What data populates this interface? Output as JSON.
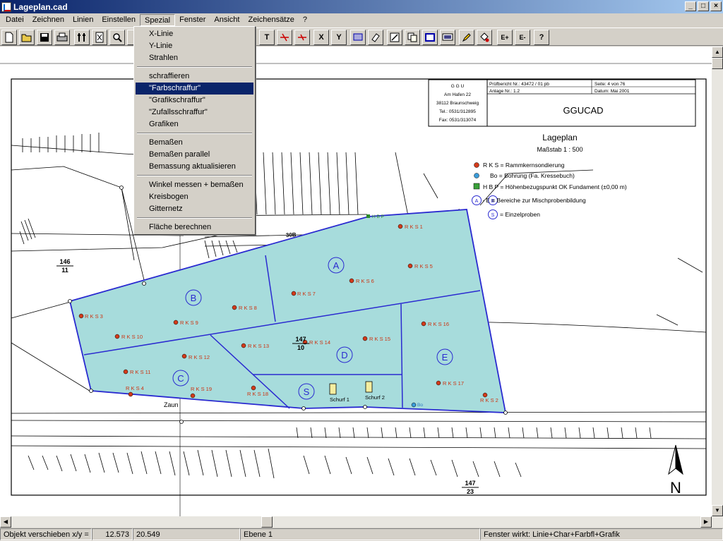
{
  "window": {
    "title": "Lageplan.cad",
    "min": "_",
    "max": "□",
    "close": "×"
  },
  "menu": [
    "Datei",
    "Zeichnen",
    "Linien",
    "Einstellen",
    "Spezial",
    "Fenster",
    "Ansicht",
    "Zeichensätze",
    "?"
  ],
  "toolbar_glyphs": [
    "T",
    "X",
    "Y",
    "E+",
    "E-",
    "?"
  ],
  "dropdown": {
    "items": [
      "X-Linie",
      "Y-Linie",
      "Strahlen",
      "schraffieren",
      "\"Farbschraffur\"",
      "\"Grafikschraffur\"",
      "\"Zufallsschraffur\"",
      "Grafiken",
      "Bemaßen",
      "Bemaßen parallel",
      "Bemassung aktualisieren",
      "Winkel messen + bemaßen",
      "Kreisbogen",
      "Gitternetz",
      "Fläche berechnen"
    ]
  },
  "titleblock": {
    "org": [
      "G G U",
      "Am Hafen 22",
      "38112 Braunschweig",
      "Tel.: 0531/312895",
      "Fax: 0531/313074"
    ],
    "report": "Prüfbericht Nr.: 43472 / 01 pb",
    "sheet": "Seite: 4 von 76",
    "appendix": "Anlage Nr.: 1.2",
    "date": "Datum: Mai 2001",
    "app": "GGUCAD"
  },
  "plan": {
    "title": "Lageplan",
    "scale": "Maßstab 1 : 500",
    "legend": [
      "R K S = Rammkernsondierung",
      "Bo = Bohrung (Fa. Kressebuch)",
      "H B P = Höhenbezugspunkt OK Fundament (±0,00 m)",
      "· E = Bereiche zur Mischprobenbildung",
      "= Einzelproben"
    ],
    "legend_circle_a": "A",
    "legend_circle_e": "E",
    "legend_circle_s": "S",
    "parcels": [
      {
        "top": "146",
        "bottom": "11"
      },
      {
        "top": "147",
        "bottom": "10"
      },
      {
        "top": "147",
        "bottom": "23"
      }
    ],
    "street_number": "30B",
    "zaun": "Zaun",
    "hbp": "H B P",
    "bo": "Bo",
    "north": "N",
    "areas": [
      "A",
      "B",
      "C",
      "D",
      "E",
      "S"
    ],
    "schurf": [
      "Schurf 1",
      "Schurf 2"
    ],
    "rks_labels": [
      "R K S  1",
      "R K S  2",
      "R K S  3",
      "R K S  4",
      "R K S  5",
      "R K S  6",
      "R K S  7",
      "R K S  8",
      "R K S  9",
      "R K S  10",
      "R K S  11",
      "R K S  12",
      "R K S  13",
      "R K S  14",
      "R K S  15",
      "R K S  16",
      "R K S  17",
      "R K S  18",
      "R K S  19"
    ]
  },
  "status": {
    "action": "Objekt verschieben  x/y =",
    "x": "12.573",
    "y": "20.549",
    "layer": "Ebene 1",
    "mode": "Fenster wirkt: Linie+Char+Farbfl+Grafik"
  }
}
